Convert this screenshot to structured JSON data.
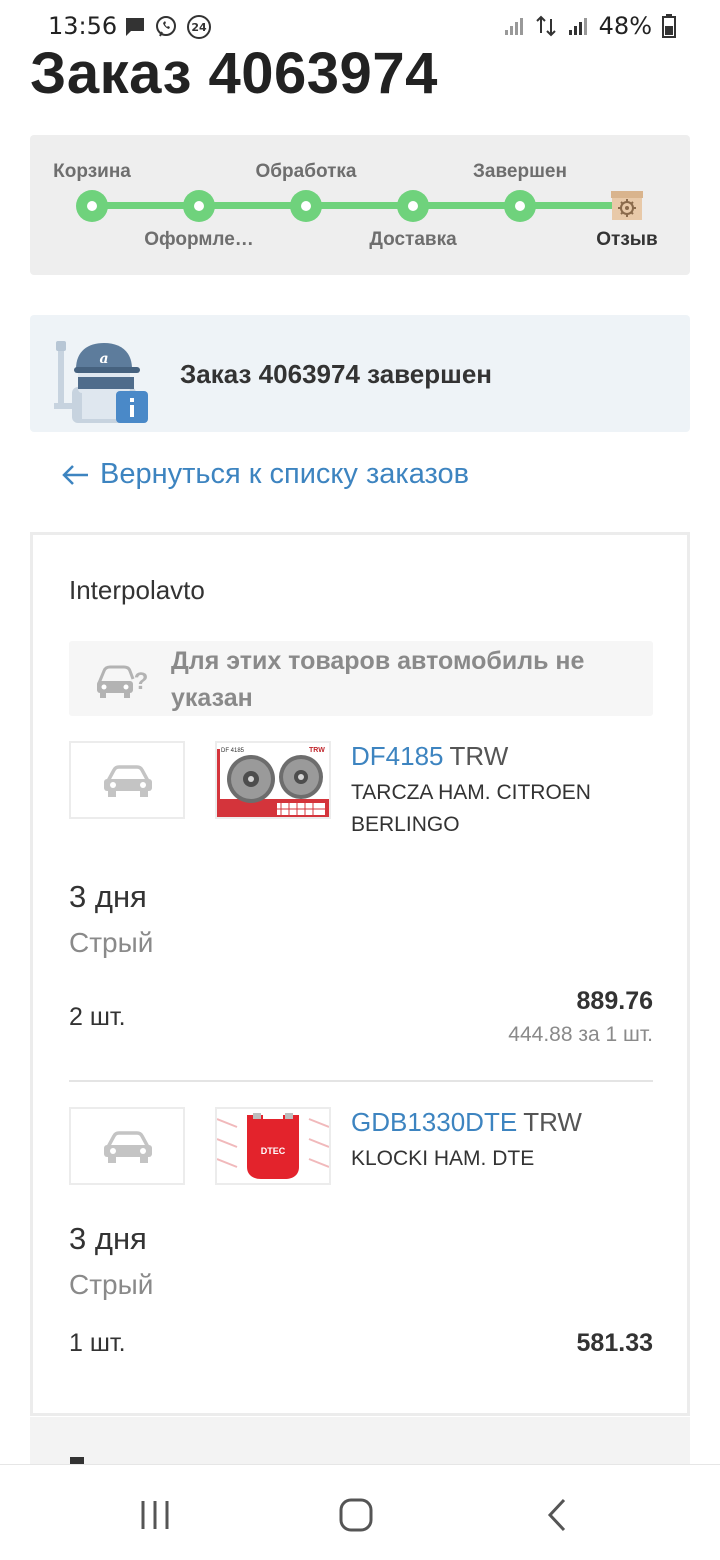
{
  "status_bar": {
    "time": "13:56",
    "notification_badge": "24",
    "battery": "48%"
  },
  "page": {
    "title": "Заказ 4063974"
  },
  "progress": {
    "steps": [
      {
        "label": "Корзина",
        "position": "top"
      },
      {
        "label": "Оформле…",
        "position": "bottom"
      },
      {
        "label": "Обработка",
        "position": "top"
      },
      {
        "label": "Доставка",
        "position": "bottom"
      },
      {
        "label": "Завершен",
        "position": "top"
      },
      {
        "label": "Отзыв",
        "position": "bottom"
      }
    ],
    "accent_color": "#6fd27c"
  },
  "status": {
    "text": "Заказ 4063974 завершен"
  },
  "back_link": {
    "label": "Вернуться к списку заказов"
  },
  "order": {
    "seller": "Interpolavto",
    "no_car_notice": "Для этих товаров автомобиль не указан",
    "items": [
      {
        "code": "DF4185",
        "brand": "TRW",
        "description": "TARCZA HAM. CITROEN BERLINGO",
        "delivery": "3 дня",
        "city": "Стрый",
        "quantity": "2 шт.",
        "total": "889.76",
        "unit_price": "444.88 за 1 шт."
      },
      {
        "code": "GDB1330DTE",
        "brand": "TRW",
        "description": "KLOCKI HAM. DTE",
        "delivery": "3 дня",
        "city": "Стрый",
        "quantity": "1 шт.",
        "total": "581.33"
      }
    ]
  },
  "colors": {
    "link": "#3d84c0",
    "progress": "#6fd27c",
    "status_bg": "#eef3f7"
  }
}
